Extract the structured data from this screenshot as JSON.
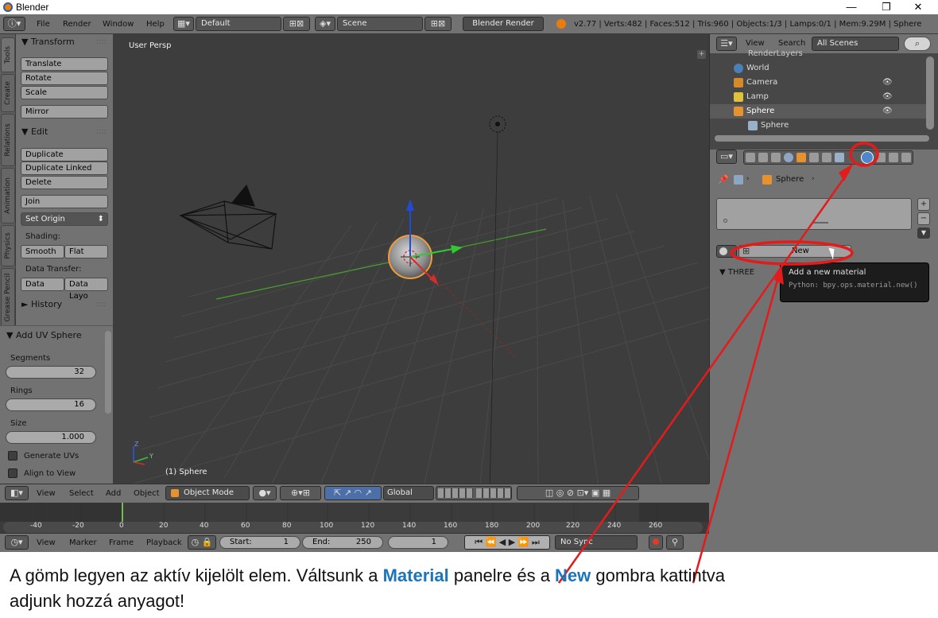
{
  "window": {
    "title": "Blender",
    "min_symbol": "—",
    "max_symbol": "❐",
    "close_symbol": "✕"
  },
  "topbar": {
    "menus": [
      "File",
      "Render",
      "Window",
      "Help"
    ],
    "layout": "Default",
    "scene": "Scene",
    "engine": "Blender Render",
    "stats": "v2.77 | Verts:482 | Faces:512 | Tris:960 | Objects:1/3 | Lamps:0/1 | Mem:9.29M | Sphere"
  },
  "tabs": [
    "Tools",
    "Create",
    "Relations",
    "Animation",
    "Physics",
    "Grease Pencil"
  ],
  "shelf": {
    "transform": {
      "title": "Transform",
      "buttons": [
        "Translate",
        "Rotate",
        "Scale",
        "Mirror"
      ]
    },
    "edit": {
      "title": "Edit",
      "buttons": [
        "Duplicate",
        "Duplicate Linked",
        "Delete",
        "Join"
      ],
      "set_origin": "Set Origin",
      "shading_label": "Shading:",
      "smooth": "Smooth",
      "flat": "Flat",
      "data_transfer_label": "Data Transfer:",
      "data": "Data",
      "data_layo": "Data Layo"
    },
    "history": {
      "title": "History"
    },
    "operator": {
      "title": "Add UV Sphere",
      "segments_label": "Segments",
      "segments": "32",
      "rings_label": "Rings",
      "rings": "16",
      "size_label": "Size",
      "size": "1.000",
      "generate_uvs": "Generate UVs",
      "align_to_view": "Align to View"
    }
  },
  "viewport": {
    "perspective": "User Persp",
    "object_label": "(1) Sphere",
    "axis_z": "Z",
    "axis_y": "Y"
  },
  "outliner": {
    "view": "View",
    "search": "Search",
    "filter": "All Scenes",
    "items": [
      "RenderLayers",
      "World",
      "Camera",
      "Lamp",
      "Sphere",
      "Sphere"
    ]
  },
  "properties": {
    "breadcrumb_object": "Sphere",
    "new_button": "New",
    "tooltip_title": "Add a new material",
    "tooltip_python": "Python: bpy.ops.material.new()",
    "section": "THREE"
  },
  "viewhdr": {
    "menus": [
      "View",
      "Select",
      "Add",
      "Object"
    ],
    "mode": "Object Mode",
    "orientation": "Global"
  },
  "timeline": {
    "ticks": [
      "-40",
      "-20",
      "0",
      "20",
      "40",
      "60",
      "80",
      "100",
      "120",
      "140",
      "160",
      "180",
      "200",
      "220",
      "240",
      "260"
    ],
    "menus": [
      "View",
      "Marker",
      "Frame",
      "Playback"
    ],
    "start_label": "Start:",
    "start": "1",
    "end_label": "End:",
    "end": "250",
    "current": "1",
    "sync": "No Sync"
  },
  "caption": {
    "part1": "A gömb legyen az aktív kijelölt elem. Váltsunk a ",
    "material": "Material",
    "part2": " panelre és a ",
    "new": "New",
    "part3": " gombra kattintva",
    "line2": "adjunk hozzá anyagot!"
  },
  "colors": {
    "annotation": "#e31b1b",
    "highlight": "#1a75bc",
    "selection": "#f29d37"
  }
}
